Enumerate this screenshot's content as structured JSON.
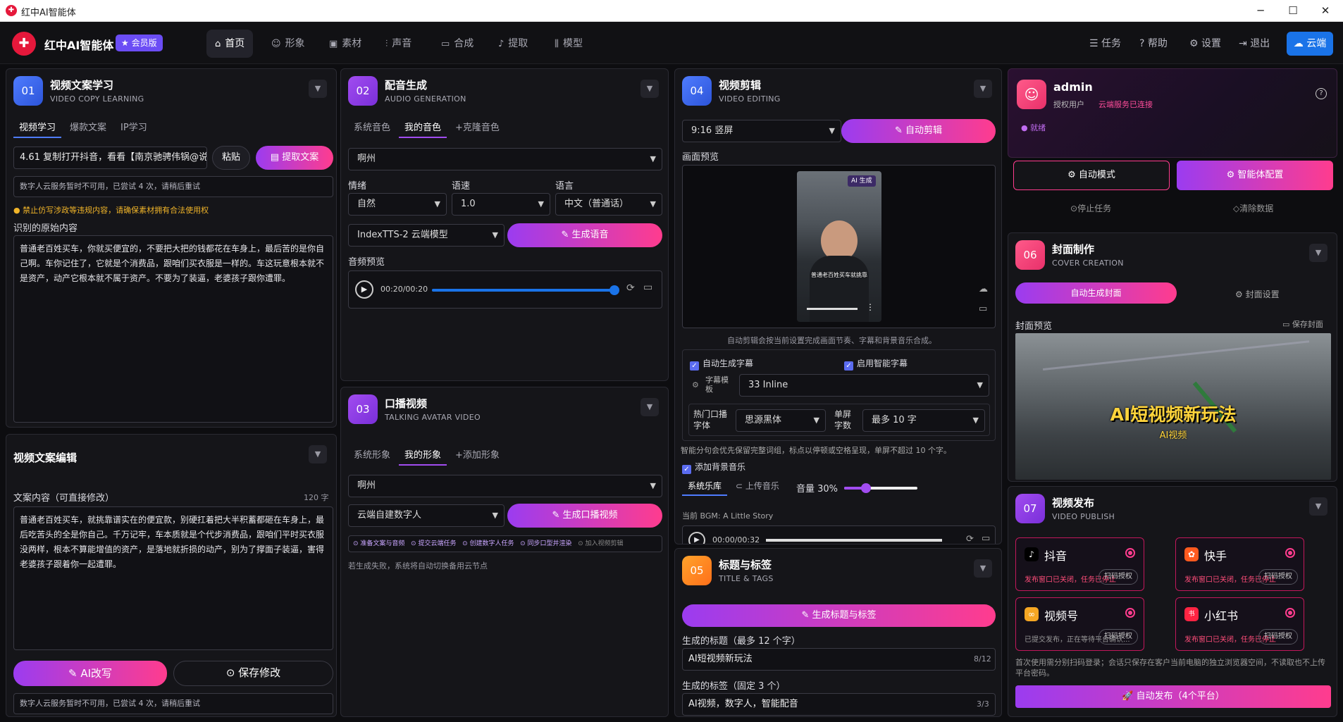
{
  "window": {
    "title": "红中AI智能体",
    "logo_char": "✚"
  },
  "nav": {
    "brand": "红中AI智能体",
    "vip": "★ 会员版",
    "items": [
      {
        "label": "首页",
        "icon": "⌂"
      },
      {
        "label": "形象",
        "icon": "☺"
      },
      {
        "label": "素材",
        "icon": "▣"
      },
      {
        "label": "声音",
        "icon": "⫶"
      },
      {
        "label": "合成",
        "icon": "▭"
      },
      {
        "label": "提取",
        "icon": "♪"
      },
      {
        "label": "模型",
        "icon": "⫼"
      }
    ],
    "right": [
      {
        "label": "任务",
        "icon": "☰"
      },
      {
        "label": "帮助",
        "icon": "?"
      },
      {
        "label": "设置",
        "icon": "⚙"
      },
      {
        "label": "退出",
        "icon": "⇥"
      }
    ],
    "cloud": "☁ 云端"
  },
  "p01": {
    "num": "01",
    "title": "视频文案学习",
    "sub": "VIDEO COPY LEARNING",
    "tabs": [
      "视频学习",
      "爆款文案",
      "IP学习"
    ],
    "url": "4.61 复制打开抖音，看看【南京驰骋伟锅@说老",
    "paste": "粘贴",
    "extract": "提取文案",
    "status": "数字人云服务暂时不可用，已尝试 4 次，请稍后重试",
    "warn": "● 禁止仿写涉政等违规内容，请确保素材拥有合法使用权",
    "orig_label": "识别的原始内容",
    "orig_text": "普通老百姓买车，你就买便宜的，不要把大把的钱都花在车身上，最后苦的是你自己啊。车你记住了，它就是个消费品，跟咱们买衣服是一样的。车这玩意根本就不是资产，动产它根本就不属于资产。不要为了装逼，老婆孩子跟你遭罪。"
  },
  "pedit": {
    "title": "视频文案编辑",
    "content_label": "文案内容（可直接修改）",
    "count": "120 字",
    "text": "普通老百姓买车，就挑靠谱实在的便宜款，别硬扛着把大半积蓄都砸在车身上，最后吃苦头的全是你自己。千万记牢，车本质就是个代步消费品，跟咱们平时买衣服没两样，根本不算能增值的资产，是落地就折损的动产，别为了撑面子装逼，害得老婆孩子跟着你一起遭罪。",
    "ai": "AI改写",
    "save": "保存修改",
    "status": "数字人云服务暂时不可用，已尝试 4 次，请稍后重试"
  },
  "p02": {
    "num": "02",
    "title": "配音生成",
    "sub": "AUDIO GENERATION",
    "tabs": [
      "系统音色",
      "我的音色",
      "+克隆音色"
    ],
    "voice": "啊州",
    "emotion_label": "情绪",
    "speed_label": "语速",
    "lang_label": "语言",
    "emotion": "自然",
    "speed": "1.0",
    "lang": "中文（普通话）",
    "model": "IndexTTS-2 云端模型",
    "gen": "生成语音",
    "preview_label": "音频预览",
    "time": "00:20/00:20",
    "progress": 1.0
  },
  "p03": {
    "num": "03",
    "title": "口播视频",
    "sub": "TALKING AVATAR VIDEO",
    "tabs": [
      "系统形象",
      "我的形象",
      "+添加形象"
    ],
    "avatar": "啊州",
    "type": "云端自建数字人",
    "gen": "生成口播视频",
    "steps": [
      "准备文案与音频",
      "提交云端任务",
      "创建数字人任务",
      "同步口型并渲染",
      "加入视频剪辑"
    ],
    "note": "若生成失败，系统将自动切换备用云节点"
  },
  "p04": {
    "num": "04",
    "title": "视频剪辑",
    "sub": "VIDEO EDITING",
    "ratio": "9:16 竖屏",
    "auto": "自动剪辑",
    "preview_label": "画面预览",
    "ai_tag": "AI 生成",
    "caption": "普通老百姓买车就挑靠",
    "hint": "自动剪辑会按当前设置完成画面节奏、字幕和背景音乐合成。",
    "auto_sub": "自动生成字幕",
    "smart_sub": "启用智能字幕",
    "tpl_label": "字幕模板",
    "tpl": "33 Inline",
    "font_label": "热门口播字体",
    "font": "思源黑体",
    "single_label": "单屏字数",
    "single": "最多 10 字",
    "sub_note": "智能分句会优先保留完整词组，标点以停顿或空格呈现，单屏不超过 10 个字。",
    "bgm": "添加背景音乐",
    "music_tabs": [
      "系统乐库",
      "上传音乐"
    ],
    "volume": "音量 30%",
    "volume_value": 0.3,
    "current_bgm": "当前 BGM:  A Little Story",
    "bgm_time": "00:00/00:32"
  },
  "p05": {
    "num": "05",
    "title": "标题与标签",
    "sub": "TITLE & TAGS",
    "gen": "生成标题与标签",
    "title_label": "生成的标题（最多 12 个字）",
    "title_val": "AI短视频新玩法",
    "title_count": "8/12",
    "tags_label": "生成的标签（固定 3 个）",
    "tags_val": "AI视频，数字人，智能配音",
    "tags_count": "3/3"
  },
  "admin": {
    "name": "admin",
    "role": "授权用户",
    "cloud": "云端服务已连接",
    "status": "● 就绪",
    "auto": "自动模式",
    "config": "智能体配置",
    "stop": "停止任务",
    "clear": "清除数据"
  },
  "p06": {
    "num": "06",
    "title": "封面制作",
    "sub": "COVER CREATION",
    "auto": "自动生成封面",
    "settings": "封面设置",
    "preview_label": "封面预览",
    "save": "保存封面",
    "cover_title": "AI短视频新玩法",
    "cover_sub": "AI视频"
  },
  "p07": {
    "num": "07",
    "title": "视频发布",
    "sub": "VIDEO PUBLISH",
    "platforms": [
      {
        "name": "抖音",
        "icon": "♪",
        "color": "#111",
        "status": "发布窗口已关闭，任务已停止",
        "btn": "扫码授权"
      },
      {
        "name": "快手",
        "icon": "✿",
        "color": "#ff5a1f",
        "status": "发布窗口已关闭，任务已停止",
        "btn": "扫码授权"
      },
      {
        "name": "视频号",
        "icon": "∞",
        "color": "#f5a623",
        "status": "已提交发布，正在等待平台确认...",
        "btn": "扫码授权"
      },
      {
        "name": "小红书",
        "icon": "书",
        "color": "#ff2442",
        "status": "发布窗口已关闭，任务已停止",
        "btn": "扫码授权"
      }
    ],
    "note": "首次使用需分别扫码登录；会话只保存在客户当前电脑的独立浏览器空间，不读取也不上传平台密码。",
    "publish": "自动发布（4个平台）"
  }
}
